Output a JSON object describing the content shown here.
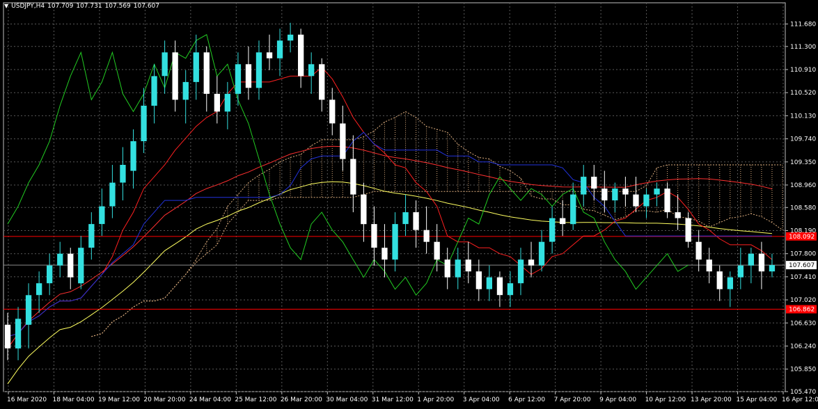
{
  "header": {
    "symbol": "USDJPY,H4",
    "open": "107.709",
    "high": "107.731",
    "low": "107.569",
    "close": "107.607"
  },
  "colors": {
    "background": "#000000",
    "grid": "#5a5a5a",
    "bull": "#33e0e0",
    "bear": "#ffffff",
    "tenkan": "#ff2020",
    "kijun": "#2233dd",
    "chikou": "#22cc22",
    "cloud": "#e0b080",
    "ma_yellow": "#ffff60",
    "ma_red": "#ff3030",
    "level_line": "#ff0000",
    "badge_red": "#ff0000"
  },
  "chart_data": {
    "type": "candlestick",
    "ylim": [
      105.47,
      111.85
    ],
    "y_ticks": [
      "111.680",
      "111.300",
      "110.910",
      "110.520",
      "110.130",
      "109.740",
      "109.350",
      "108.960",
      "108.580",
      "108.190",
      "107.800",
      "107.410",
      "107.020",
      "106.630",
      "106.240",
      "105.850",
      "105.470"
    ],
    "x_labels": [
      "16 Mar 2020",
      "18 Mar 04:00",
      "19 Mar 12:00",
      "20 Mar 20:00",
      "24 Mar 04:00",
      "25 Mar 12:00",
      "26 Mar 20:00",
      "30 Mar 04:00",
      "31 Mar 12:00",
      "1 Apr 20:00",
      "3 Apr 04:00",
      "6 Apr 12:00",
      "7 Apr 20:00",
      "9 Apr 04:00",
      "10 Apr 12:00",
      "13 Apr 20:00",
      "15 Apr 04:00",
      "16 Apr 12:00"
    ],
    "current_price": "107.607",
    "levels": [
      {
        "price": 108.092,
        "label": "108.092"
      },
      {
        "price": 106.862,
        "label": "106.862"
      }
    ],
    "candles": [
      [
        106.6,
        106.8,
        106.0,
        106.2
      ],
      [
        106.2,
        106.9,
        106.0,
        106.7
      ],
      [
        106.6,
        107.3,
        106.2,
        107.1
      ],
      [
        107.1,
        107.5,
        106.8,
        107.3
      ],
      [
        107.3,
        107.8,
        107.1,
        107.6
      ],
      [
        107.6,
        108.0,
        107.4,
        107.8
      ],
      [
        107.8,
        107.9,
        107.2,
        107.4
      ],
      [
        107.3,
        108.1,
        107.2,
        107.9
      ],
      [
        107.9,
        108.5,
        107.7,
        108.3
      ],
      [
        108.3,
        108.9,
        108.1,
        108.6
      ],
      [
        108.6,
        109.3,
        108.4,
        109.0
      ],
      [
        109.0,
        109.6,
        108.7,
        109.3
      ],
      [
        109.2,
        109.9,
        108.9,
        109.7
      ],
      [
        109.7,
        110.6,
        109.5,
        110.3
      ],
      [
        110.3,
        111.0,
        110.0,
        110.8
      ],
      [
        110.8,
        111.4,
        110.5,
        111.2
      ],
      [
        111.2,
        111.4,
        110.2,
        110.4
      ],
      [
        110.4,
        110.9,
        110.0,
        110.7
      ],
      [
        110.7,
        111.5,
        110.4,
        111.2
      ],
      [
        111.2,
        111.3,
        110.2,
        110.5
      ],
      [
        110.5,
        110.8,
        110.0,
        110.2
      ],
      [
        110.2,
        110.7,
        109.9,
        110.5
      ],
      [
        110.5,
        111.2,
        110.3,
        111.0
      ],
      [
        111.0,
        111.3,
        110.4,
        110.6
      ],
      [
        110.6,
        111.4,
        110.4,
        111.2
      ],
      [
        111.2,
        111.5,
        110.9,
        111.1
      ],
      [
        111.1,
        111.6,
        110.8,
        111.4
      ],
      [
        111.4,
        111.7,
        111.2,
        111.5
      ],
      [
        111.5,
        111.6,
        110.6,
        110.8
      ],
      [
        110.8,
        111.2,
        110.5,
        111.0
      ],
      [
        111.0,
        111.1,
        110.2,
        110.4
      ],
      [
        110.4,
        110.6,
        109.8,
        110.0
      ],
      [
        110.0,
        110.3,
        109.2,
        109.4
      ],
      [
        109.4,
        109.8,
        108.5,
        108.8
      ],
      [
        108.8,
        109.0,
        108.0,
        108.3
      ],
      [
        108.3,
        108.6,
        107.6,
        107.9
      ],
      [
        107.9,
        108.3,
        107.4,
        107.7
      ],
      [
        107.7,
        108.5,
        107.5,
        108.3
      ],
      [
        108.3,
        108.8,
        108.1,
        108.5
      ],
      [
        108.5,
        108.7,
        107.9,
        108.2
      ],
      [
        108.2,
        108.6,
        107.8,
        108.0
      ],
      [
        108.0,
        108.3,
        107.5,
        107.7
      ],
      [
        107.7,
        107.9,
        107.2,
        107.4
      ],
      [
        107.4,
        107.9,
        107.2,
        107.7
      ],
      [
        107.7,
        108.0,
        107.3,
        107.5
      ],
      [
        107.5,
        107.7,
        107.0,
        107.2
      ],
      [
        107.2,
        107.6,
        107.0,
        107.4
      ],
      [
        107.4,
        107.5,
        106.9,
        107.1
      ],
      [
        107.1,
        107.5,
        106.9,
        107.3
      ],
      [
        107.3,
        107.9,
        107.1,
        107.7
      ],
      [
        107.7,
        108.0,
        107.4,
        107.6
      ],
      [
        107.6,
        108.2,
        107.5,
        108.0
      ],
      [
        108.0,
        108.6,
        107.8,
        108.4
      ],
      [
        108.4,
        108.7,
        108.1,
        108.3
      ],
      [
        108.3,
        109.0,
        108.2,
        108.8
      ],
      [
        108.8,
        109.3,
        108.6,
        109.1
      ],
      [
        109.1,
        109.3,
        108.7,
        108.9
      ],
      [
        108.9,
        109.2,
        108.5,
        108.7
      ],
      [
        108.7,
        109.0,
        108.5,
        108.9
      ],
      [
        108.9,
        109.1,
        108.6,
        108.8
      ],
      [
        108.8,
        109.1,
        108.5,
        108.6
      ],
      [
        108.6,
        108.9,
        108.4,
        108.8
      ],
      [
        108.8,
        109.0,
        108.6,
        108.9
      ],
      [
        108.9,
        109.0,
        108.4,
        108.5
      ],
      [
        108.5,
        108.8,
        108.2,
        108.4
      ],
      [
        108.4,
        108.5,
        107.9,
        108.0
      ],
      [
        108.0,
        108.2,
        107.5,
        107.7
      ],
      [
        107.7,
        107.9,
        107.3,
        107.5
      ],
      [
        107.5,
        107.6,
        107.0,
        107.2
      ],
      [
        107.2,
        107.5,
        106.9,
        107.4
      ],
      [
        107.4,
        107.9,
        107.2,
        107.6
      ],
      [
        107.6,
        107.9,
        107.3,
        107.8
      ],
      [
        107.8,
        108.0,
        107.2,
        107.5
      ],
      [
        107.5,
        107.8,
        107.4,
        107.607
      ]
    ],
    "bull_color_name": "cyan",
    "bear_color_name": "white"
  }
}
